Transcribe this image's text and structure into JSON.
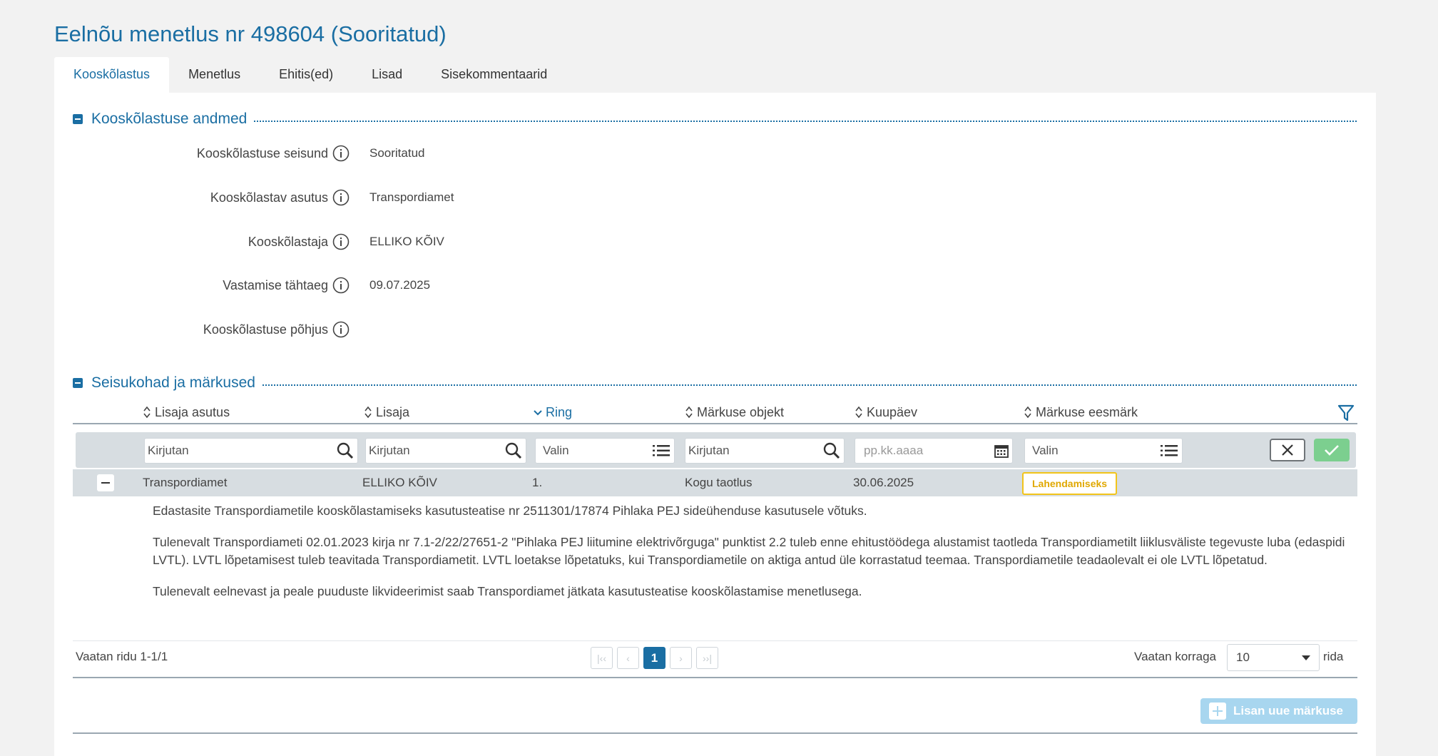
{
  "page": {
    "title": "Eelnõu menetlus nr 498604 (Sooritatud)"
  },
  "tabs": [
    {
      "label": "Kooskõlastus",
      "active": true
    },
    {
      "label": "Menetlus",
      "active": false
    },
    {
      "label": "Ehitis(ed)",
      "active": false
    },
    {
      "label": "Lisad",
      "active": false
    },
    {
      "label": "Sisekommentaarid",
      "active": false
    }
  ],
  "section1": {
    "title": "Kooskõlastuse andmed",
    "fields": [
      {
        "label": "Kooskõlastuse seisund",
        "value": "Sooritatud"
      },
      {
        "label": "Kooskõlastav asutus",
        "value": "Transpordiamet"
      },
      {
        "label": "Kooskõlastaja",
        "value": "ELLIKO KÕIV"
      },
      {
        "label": "Vastamise tähtaeg",
        "value": "09.07.2025"
      },
      {
        "label": "Kooskõlastuse põhjus",
        "value": ""
      }
    ]
  },
  "section2": {
    "title": "Seisukohad ja märkused",
    "columns": [
      {
        "label": "Lisaja asutus",
        "sort": "both"
      },
      {
        "label": "Lisaja",
        "sort": "both"
      },
      {
        "label": "Ring",
        "sort": "desc"
      },
      {
        "label": "Märkuse objekt",
        "sort": "both"
      },
      {
        "label": "Kuupäev",
        "sort": "both"
      },
      {
        "label": "Märkuse eesmärk",
        "sort": "both"
      }
    ],
    "filters": [
      {
        "placeholder": "Kirjutan",
        "icon": "search-icon"
      },
      {
        "placeholder": "Kirjutan",
        "icon": "search-icon"
      },
      {
        "placeholder": "Valin",
        "icon": "list-icon"
      },
      {
        "placeholder": "Kirjutan",
        "icon": "search-icon"
      },
      {
        "placeholder": "pp.kk.aaaa",
        "icon": "calendar-icon"
      },
      {
        "placeholder": "Valin",
        "icon": "list-icon"
      }
    ],
    "rows": [
      {
        "lisaja_asutus": "Transpordiamet",
        "lisaja": "ELLIKO KÕIV",
        "ring": "1.",
        "objekt": "Kogu taotlus",
        "kuupaev": "30.06.2025",
        "eesmark": "Lahendamiseks",
        "details": [
          "Edastasite Transpordiametile kooskõlastamiseks kasutusteatise nr 2511301/17874 Pihlaka PEJ sideühenduse kasutusele võtuks.",
          "Tulenevalt Transpordiameti 02.01.2023 kirja nr 7.1-2/22/27651-2 \"Pihlaka PEJ liitumine elektrivõrguga\" punktist 2.2 tuleb enne ehitustöödega alustamist taotleda Transpordiametilt liiklusväliste tegevuste luba (edaspidi LVTL). LVTL lõpetamisest tuleb teavitada Transpordiametit. LVTL loetakse lõpetatuks, kui Transpordiametile on aktiga antud üle korrastatud teemaa. Transpordiametile teadaolevalt ei ole LVTL lõpetatud.",
          "Tulenevalt eelnevast ja peale puuduste likvideerimist saab Transpordiamet jätkata kasutusteatise kooskõlastamise menetlusega."
        ]
      }
    ],
    "pager": {
      "info": "Vaatan ridu 1-1/1",
      "current_page": "1",
      "per_page_label": "Vaatan korraga",
      "per_page_value": "10",
      "rows_label": "rida"
    },
    "add_button": "Lisan uue märkuse"
  },
  "colors": {
    "accent": "#1a6ea3",
    "badge_border": "#f2c41a",
    "ok_button": "#7ccf8f",
    "add_button": "#a8d6ef"
  }
}
